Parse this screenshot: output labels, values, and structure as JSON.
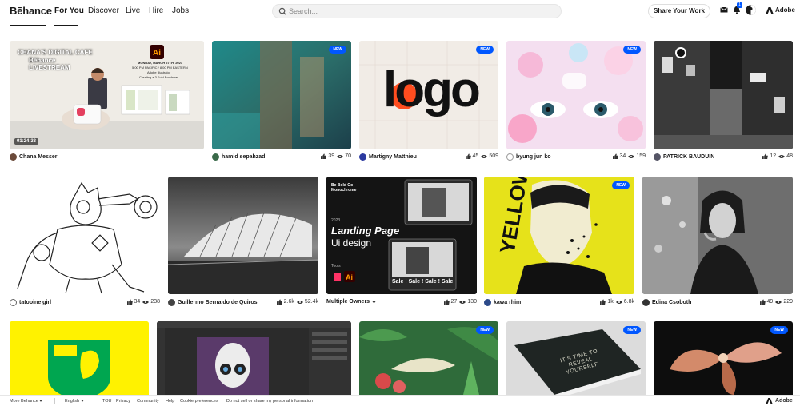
{
  "header": {
    "logo": "Bēhance",
    "nav": [
      "For You",
      "Discover",
      "Live",
      "Hire",
      "Jobs"
    ],
    "search_placeholder": "Search...",
    "share_label": "Share Your Work",
    "notification_count": "1",
    "adobe_label": "Adobe"
  },
  "cards": [
    {
      "owner": "Chana Messer",
      "likes": "",
      "views": "",
      "badge": "",
      "time": "01:24:33",
      "live_title": "CHANA'S DIGITAL CAFE",
      "live_sub": "Bēhance",
      "live_sub2": "LIVESTREAM",
      "live_date": "MONDAY, MARCH 27TH, 2023",
      "live_time": "5:00 PM PACIFIC / 8:00 PM EASTERN",
      "live_app": "Adobe Illustrator",
      "live_topic": "Creating a 3 Fold Brochure"
    },
    {
      "owner": "hamid sepahzad",
      "likes": "39",
      "views": "70",
      "badge": "NEW"
    },
    {
      "owner": "Martigny Matthieu",
      "likes": "45",
      "views": "509",
      "badge": "NEW",
      "art_text": "logo"
    },
    {
      "owner": "byung jun ko",
      "likes": "34",
      "views": "159",
      "badge": "NEW"
    },
    {
      "owner": "PATRICK BAUDUIN",
      "likes": "12",
      "views": "48",
      "badge": ""
    },
    {
      "owner": "tatooine girl",
      "likes": "34",
      "views": "238",
      "badge": ""
    },
    {
      "owner": "Guillermo Bernaldo de Quiros",
      "likes": "2.6k",
      "views": "52.4k",
      "badge": ""
    },
    {
      "owner": "Multiple Owners",
      "likes": "27",
      "views": "130",
      "badge": "",
      "lp_title": "Landing Page",
      "lp_sub": "Ui design",
      "lp_year": "2023",
      "lp_tools": "Tools",
      "lp_top": "Be Bold Go Monochrome",
      "lp_sale": "Sale ! Sale ! Sale ! Sale"
    },
    {
      "owner": "kawa rhim",
      "likes": "1k",
      "views": "6.8k",
      "badge": "NEW"
    },
    {
      "owner": "Edina Csoboth",
      "likes": "49",
      "views": "229",
      "badge": ""
    },
    {
      "badge": ""
    },
    {
      "badge": ""
    },
    {
      "badge": "NEW"
    },
    {
      "badge": "NEW",
      "book_text": "IT'S TIME TO REVEAL YOURSELF"
    },
    {
      "badge": "NEW"
    }
  ],
  "footer": {
    "more": "More Behance",
    "lang": "English",
    "links": [
      "TOU",
      "Privacy",
      "Community",
      "Help",
      "Cookie preferences",
      "Do not sell or share my personal information"
    ],
    "adobe": "Adobe"
  }
}
